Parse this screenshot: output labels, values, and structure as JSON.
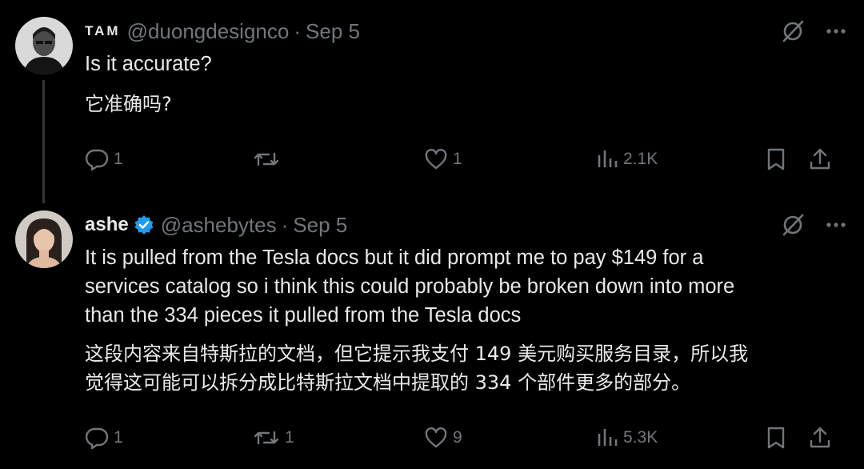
{
  "tweets": [
    {
      "display_name": "TAM",
      "handle": "@duongdesignco",
      "separator": "·",
      "date": "Sep 5",
      "text_en": "Is it accurate?",
      "text_zh": "它准确吗?",
      "replies": "1",
      "retweets": "",
      "likes": "1",
      "views": "2.1K"
    },
    {
      "display_name": "ashe",
      "handle": "@ashebytes",
      "separator": "·",
      "date": "Sep 5",
      "verified": true,
      "text_en_lines": [
        "It is pulled from the Tesla docs but it did prompt me to pay $149 for a",
        "services catalog so i think this could probably be broken down into more",
        "than the 334 pieces it pulled from the Tesla docs"
      ],
      "text_zh_lines": [
        "这段内容来自特斯拉的文档，但它提示我支付 149 美元购买服务目录，所以我",
        "觉得这可能可以拆分成比特斯拉文档中提取的 334 个部件更多的部分。"
      ],
      "replies": "1",
      "retweets": "1",
      "likes": "9",
      "views": "5.3K"
    }
  ],
  "colors": {
    "background": "#000000",
    "text": "#e7e9ea",
    "muted": "#71767b",
    "verified": "#1d9bf0",
    "thread_line": "#333639"
  },
  "icons": [
    "grok-icon",
    "more-icon",
    "reply-icon",
    "retweet-icon",
    "like-icon",
    "views-icon",
    "bookmark-icon",
    "share-icon",
    "verified-badge-icon"
  ]
}
